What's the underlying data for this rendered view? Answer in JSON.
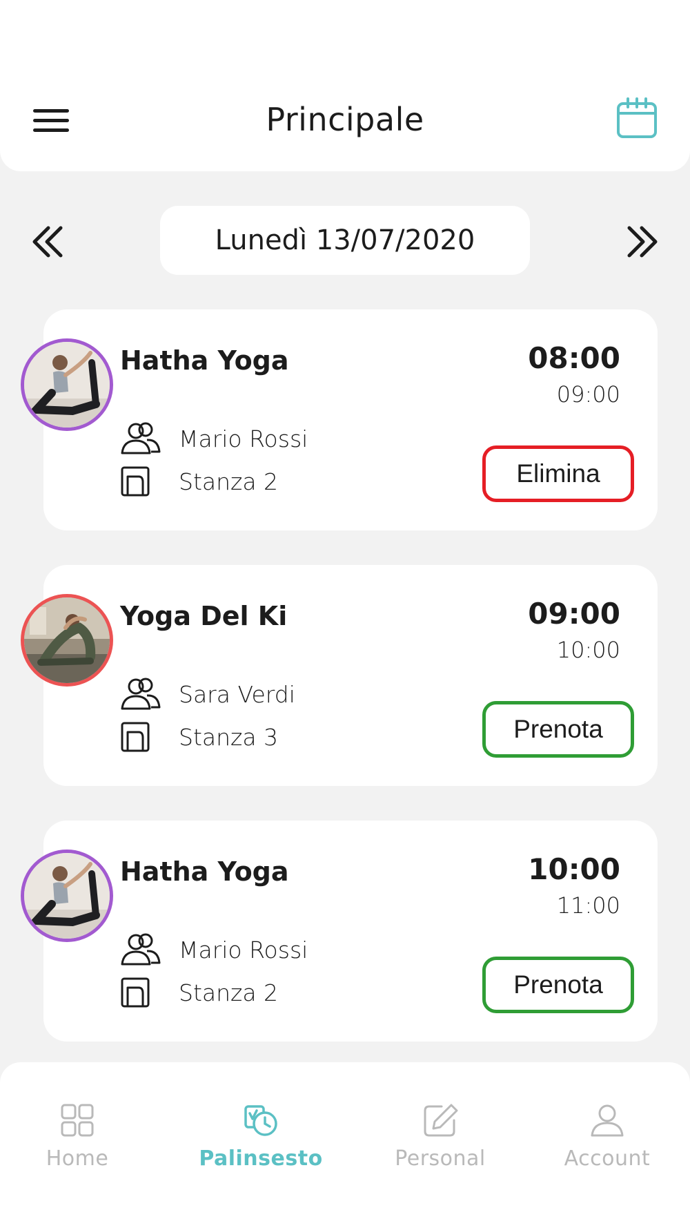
{
  "header": {
    "title": "Principale",
    "menu_icon": "hamburger-menu-icon",
    "calendar_icon": "calendar-icon",
    "accent_color": "#5bc0c4"
  },
  "date_nav": {
    "current_date": "Lunedì 13/07/2020",
    "prev_icon": "double-chevron-left-icon",
    "next_icon": "double-chevron-right-icon"
  },
  "classes": [
    {
      "title": "Hatha Yoga",
      "start": "08:00",
      "end": "09:00",
      "instructor": "Mario Rossi",
      "room": "Stanza 2",
      "action": "Elimina",
      "action_color": "#e51e25",
      "avatar_ring_color": "#a25ad0"
    },
    {
      "title": "Yoga Del Ki",
      "start": "09:00",
      "end": "10:00",
      "instructor": "Sara Verdi",
      "room": "Stanza 3",
      "action": "Prenota",
      "action_color": "#2f9d35",
      "avatar_ring_color": "#ec5353"
    },
    {
      "title": "Hatha Yoga",
      "start": "10:00",
      "end": "11:00",
      "instructor": "Mario Rossi",
      "room": "Stanza 2",
      "action": "Prenota",
      "action_color": "#2f9d35",
      "avatar_ring_color": "#a25ad0"
    }
  ],
  "bottom_nav": {
    "items": [
      {
        "label": "Home",
        "icon": "grid-icon",
        "active": false
      },
      {
        "label": "Palinsesto",
        "icon": "schedule-clock-icon",
        "active": true
      },
      {
        "label": "Personal",
        "icon": "edit-icon",
        "active": false
      },
      {
        "label": "Account",
        "icon": "user-icon",
        "active": false
      }
    ],
    "active_color": "#5bc0c4",
    "inactive_color": "#b9b9b9"
  }
}
